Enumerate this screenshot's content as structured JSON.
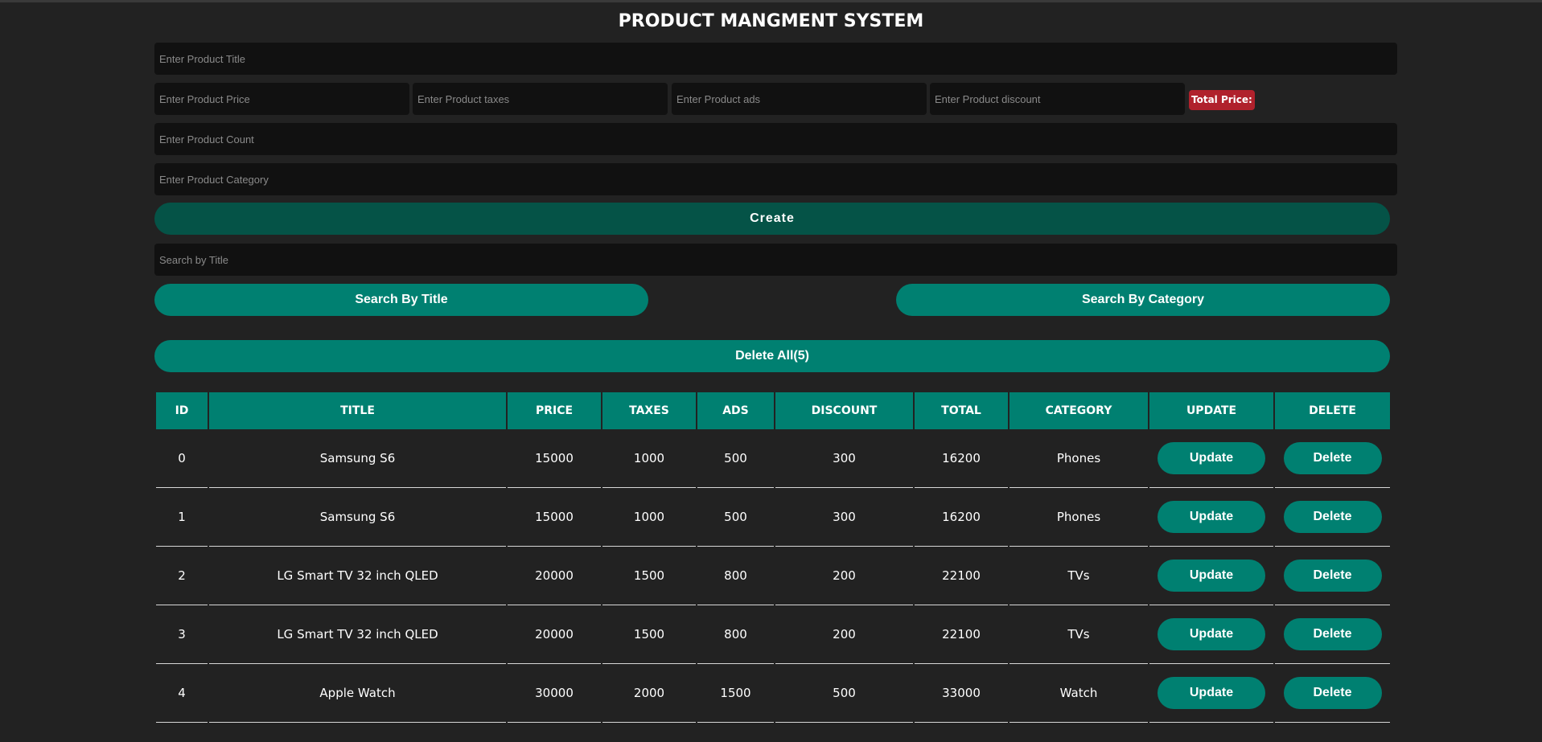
{
  "app": {
    "title": "PRODUCT MANGMENT SYSTEM"
  },
  "form": {
    "title_placeholder": "Enter Product Title",
    "price_placeholder": "Enter Product Price",
    "taxes_placeholder": "Enter Product taxes",
    "ads_placeholder": "Enter Product ads",
    "discount_placeholder": "Enter Product discount",
    "total_label": "Total Price:",
    "count_placeholder": "Enter Product Count",
    "category_placeholder": "Enter Product Category",
    "create_label": "Create"
  },
  "search": {
    "placeholder": "Search by Title",
    "by_title_label": "Search By Title",
    "by_category_label": "Search By Category"
  },
  "actions": {
    "delete_all_label": "Delete All(5)"
  },
  "table": {
    "headers": [
      "ID",
      "TITLE",
      "PRICE",
      "TAXES",
      "ADS",
      "DISCOUNT",
      "TOTAL",
      "CATEGORY",
      "UPDATE",
      "DELETE"
    ],
    "update_label": "Update",
    "delete_label": "Delete",
    "rows": [
      {
        "id": "0",
        "title": "Samsung S6",
        "price": "15000",
        "taxes": "1000",
        "ads": "500",
        "discount": "300",
        "total": "16200",
        "category": "Phones"
      },
      {
        "id": "1",
        "title": "Samsung S6",
        "price": "15000",
        "taxes": "1000",
        "ads": "500",
        "discount": "300",
        "total": "16200",
        "category": "Phones"
      },
      {
        "id": "2",
        "title": "LG Smart TV 32 inch QLED",
        "price": "20000",
        "taxes": "1500",
        "ads": "800",
        "discount": "200",
        "total": "22100",
        "category": "TVs"
      },
      {
        "id": "3",
        "title": "LG Smart TV 32 inch QLED",
        "price": "20000",
        "taxes": "1500",
        "ads": "800",
        "discount": "200",
        "total": "22100",
        "category": "TVs"
      },
      {
        "id": "4",
        "title": "Apple Watch",
        "price": "30000",
        "taxes": "2000",
        "ads": "1500",
        "discount": "500",
        "total": "33000",
        "category": "Watch"
      }
    ]
  },
  "colors": {
    "background": "#222222",
    "input_background": "#111111",
    "accent": "#008071",
    "create_button": "#055347",
    "total_badge": "#b0212c"
  }
}
